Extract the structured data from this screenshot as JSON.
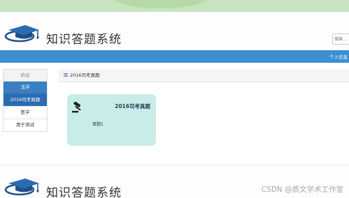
{
  "app": {
    "title": "知识答题系统"
  },
  "header": {
    "search_placeholder": "搜索..."
  },
  "navbar": {
    "user_label": "个人信息"
  },
  "sidebar": {
    "heading": "阶段",
    "items": [
      {
        "label": "法学",
        "kind": "category"
      },
      {
        "label": "2016司考真题",
        "kind": "active"
      },
      {
        "label": "医学",
        "kind": "category"
      },
      {
        "label": "用于测试",
        "kind": "normal"
      }
    ]
  },
  "panel": {
    "title": "2016司考真题",
    "card": {
      "title": "2016司考真题",
      "subtitle": "真题1",
      "icon": "gavel-icon"
    }
  },
  "watermark": {
    "text": "CSDN @质文学术工作室"
  },
  "colors": {
    "banner": "#c9e3c0",
    "navbar": "#3d8fd0",
    "sidebar_category": "#3a7fc1",
    "sidebar_active": "#2b6cb0",
    "card": "#c8ece8"
  }
}
